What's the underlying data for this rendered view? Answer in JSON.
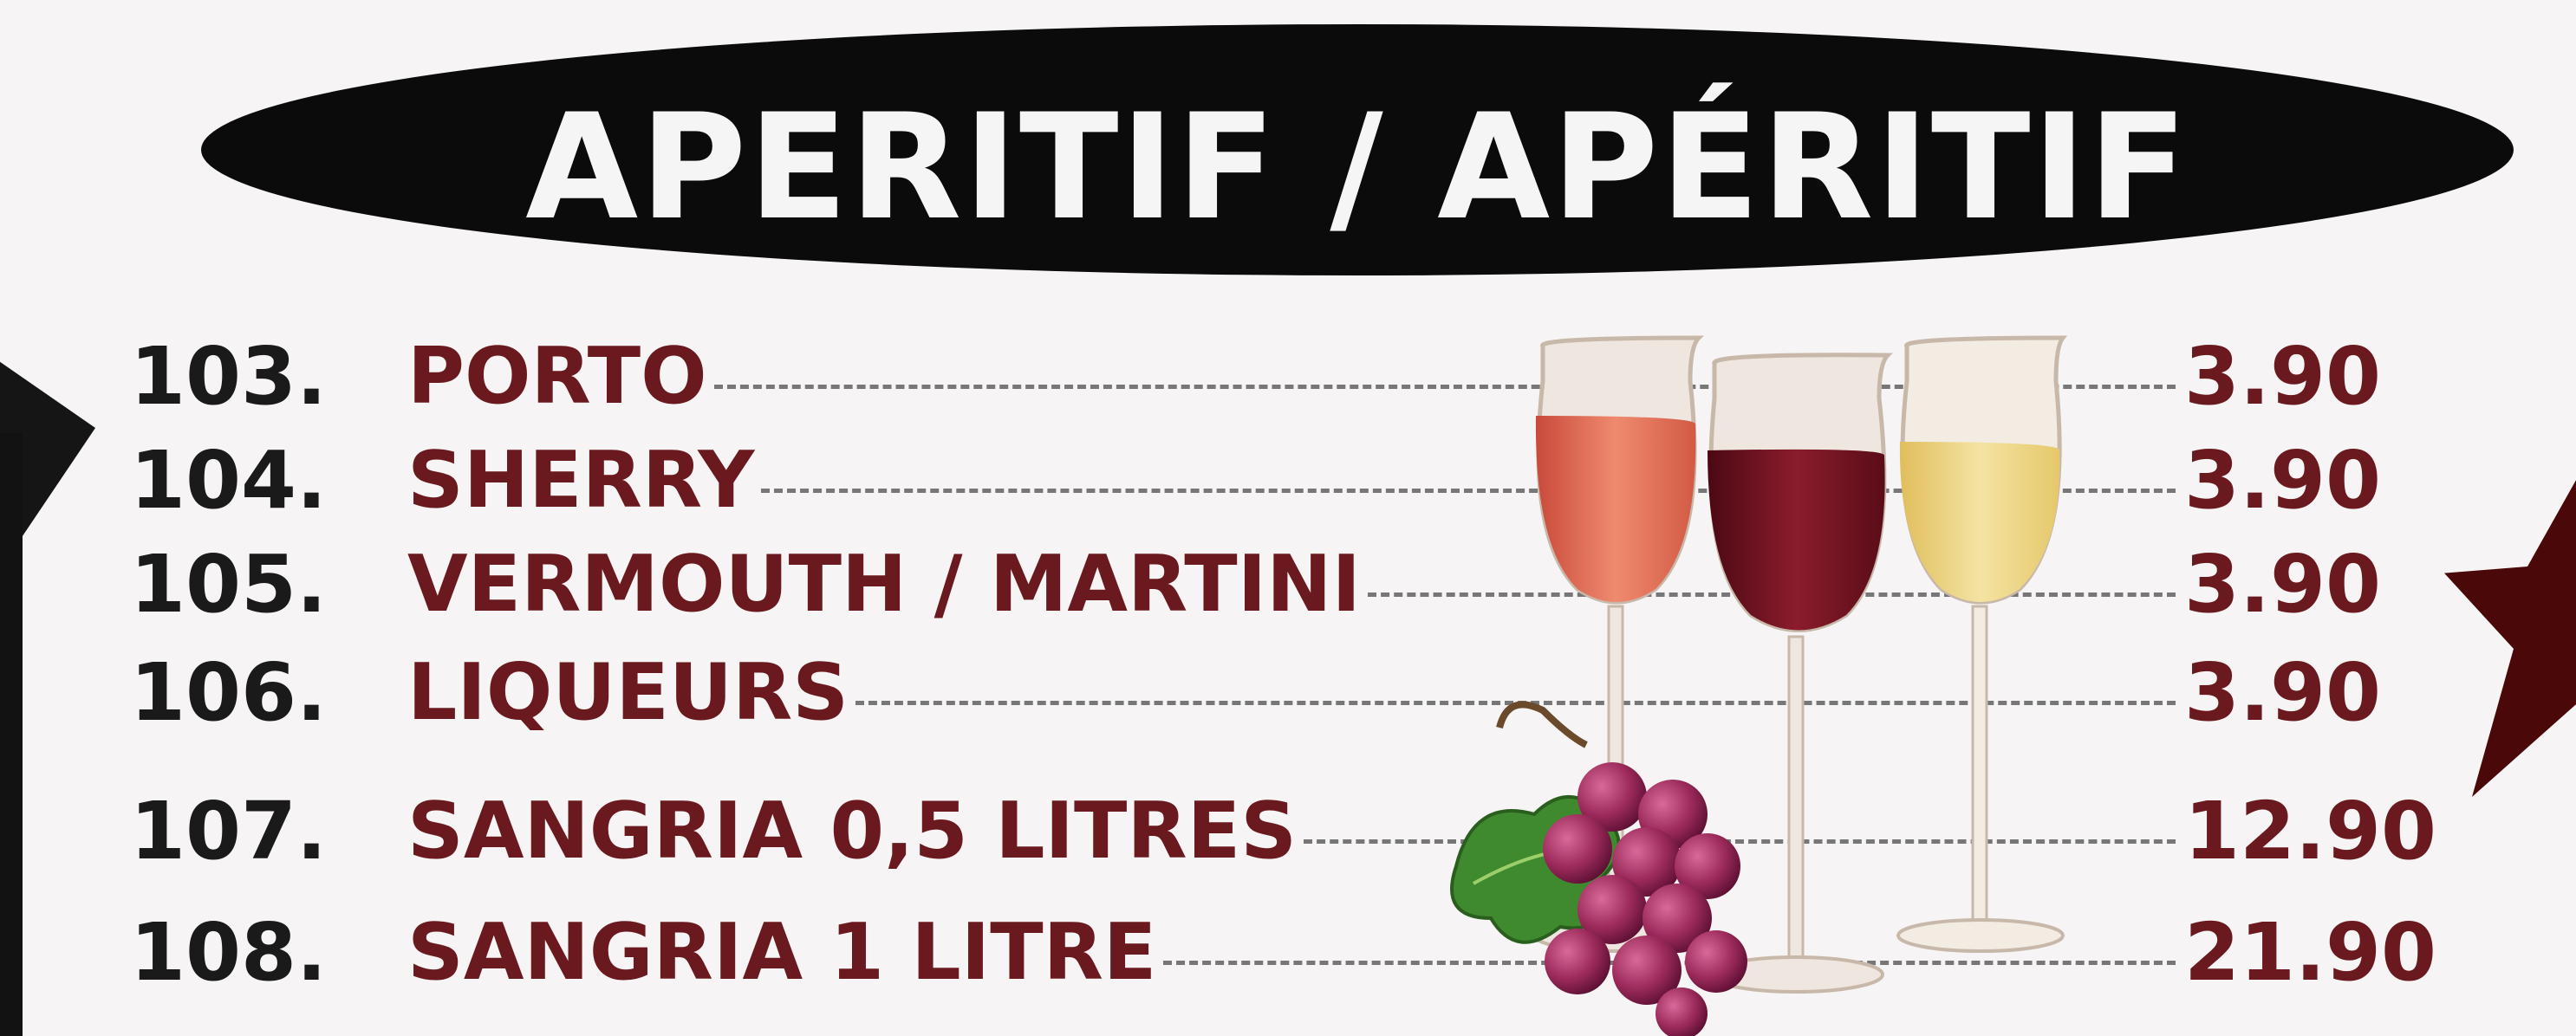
{
  "header": {
    "title": "APERITIF / APÉRITIF"
  },
  "menu": {
    "items": [
      {
        "number": "103.",
        "name": "PORTO",
        "price": "3.90"
      },
      {
        "number": "104.",
        "name": "SHERRY",
        "price": "3.90"
      },
      {
        "number": "105.",
        "name": "VERMOUTH / MARTINI",
        "price": "3.90"
      },
      {
        "number": "106.",
        "name": "LIQUEURS",
        "price": "3.90"
      },
      {
        "number": "107.",
        "name": "SANGRIA 0,5 LITRES",
        "price": "12.90"
      },
      {
        "number": "108.",
        "name": "SANGRIA 1 LITRE",
        "price": "21.90"
      }
    ]
  },
  "colors": {
    "background": "#f6f4f4",
    "title_pill": "#0b0b0b",
    "title_text": "#f5f5f5",
    "item_name": "#6a1a1e",
    "item_number": "#1a1a1a",
    "price": "#6a1a1e",
    "rose_wine": "#e0705a",
    "red_wine": "#6e1220",
    "white_wine": "#ead07a",
    "grapes": "#9b2a5a",
    "grape_leaf": "#3f8a2e"
  },
  "illustration": {
    "icons": [
      "rose-wine-glass-icon",
      "red-wine-glass-icon",
      "white-wine-glass-icon",
      "grape-bunch-icon"
    ]
  }
}
